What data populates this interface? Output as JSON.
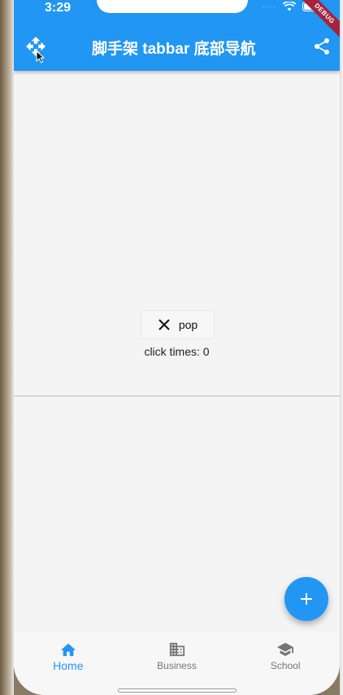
{
  "status_bar": {
    "time": "3:29",
    "debug_label": "DEBUG"
  },
  "app_bar": {
    "title": "脚手架 tabbar 底部导航",
    "leading_icon": "move-icon",
    "action_icon": "share-icon"
  },
  "body": {
    "pop_button": {
      "icon": "close-icon",
      "label": "pop"
    },
    "click_times_text": "click times: 0"
  },
  "fab": {
    "icon": "add-icon"
  },
  "bottom_nav": {
    "items": [
      {
        "label": "Home",
        "icon": "home-icon",
        "active": true
      },
      {
        "label": "Business",
        "icon": "business-icon",
        "active": false
      },
      {
        "label": "School",
        "icon": "school-icon",
        "active": false
      }
    ]
  },
  "colors": {
    "primary": "#2196f3",
    "background": "#f4f4f4",
    "inactive": "#757575",
    "debug_banner": "#a5243d"
  }
}
